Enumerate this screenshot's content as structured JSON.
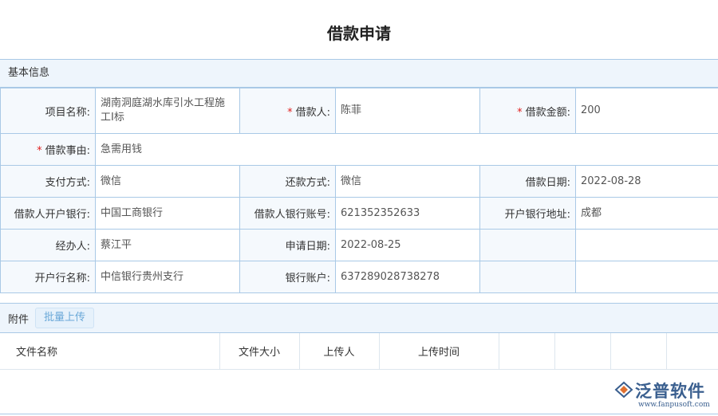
{
  "title": "借款申请",
  "basic_section": {
    "title": "基本信息"
  },
  "form": {
    "project_name": {
      "label": "项目名称:",
      "value": "湖南洞庭湖水库引水工程施工I标"
    },
    "borrower": {
      "label": "借款人:",
      "value": "陈菲",
      "required": true
    },
    "amount": {
      "label": "借款金额:",
      "value": "200",
      "required": true
    },
    "reason": {
      "label": "借款事由:",
      "value": "急需用钱",
      "required": true
    },
    "pay_method": {
      "label": "支付方式:",
      "value": "微信"
    },
    "repay_method": {
      "label": "还款方式:",
      "value": "微信"
    },
    "loan_date": {
      "label": "借款日期:",
      "value": "2022-08-28"
    },
    "borrower_bank": {
      "label": "借款人开户银行:",
      "value": "中国工商银行"
    },
    "borrower_account": {
      "label": "借款人银行账号:",
      "value": "621352352633"
    },
    "bank_address": {
      "label": "开户银行地址:",
      "value": "成都"
    },
    "handler": {
      "label": "经办人:",
      "value": "蔡江平"
    },
    "apply_date": {
      "label": "申请日期:",
      "value": "2022-08-25"
    },
    "bank_name": {
      "label": "开户行名称:",
      "value": "中信银行贵州支行"
    },
    "bank_account": {
      "label": "银行账户:",
      "value": "637289028738278"
    }
  },
  "attachments": {
    "title": "附件",
    "upload_label": "批量上传",
    "columns": [
      "文件名称",
      "文件大小",
      "上传人",
      "上传时间"
    ]
  },
  "watermark": {
    "brand": "泛普软件",
    "url": "www.fanpusoft.com",
    "color": "#3a5f8f"
  },
  "colors": {
    "border": "#a9c9e6",
    "header_bg": "#eef5fc",
    "label_bg": "#f5f9fd",
    "required": "#e02020"
  }
}
